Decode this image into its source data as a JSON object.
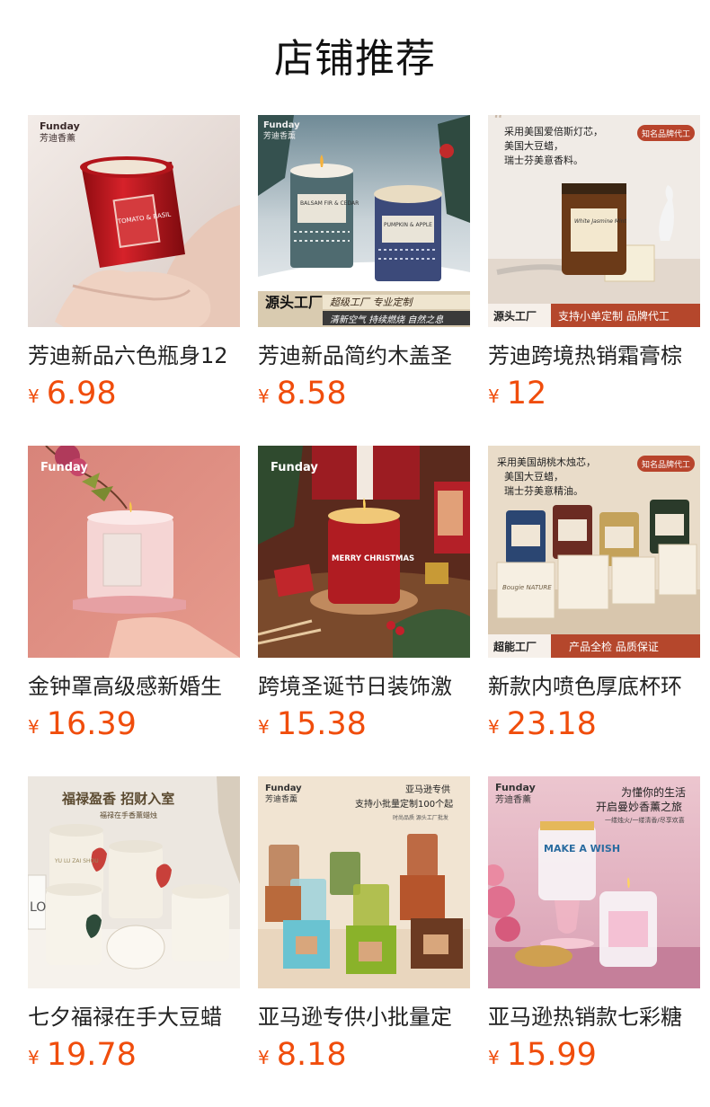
{
  "page": {
    "title": "店铺推荐"
  },
  "colors": {
    "price": "#f04d0c",
    "title": "#111111"
  },
  "products": [
    {
      "name": "芳迪新品六色瓶身12",
      "currency": "¥",
      "price": "6.98",
      "image": {
        "brand": "Funday",
        "brand_cn": "芳迪香薰",
        "jar_text": "TOMATO & BASIL"
      }
    },
    {
      "name": "芳迪新品简约木盖圣",
      "currency": "¥",
      "price": "8.58",
      "image": {
        "brand": "Funday",
        "brand_cn": "芳迪香薰",
        "jar1_text": "BALSAM FIR & CEDAR",
        "jar2_text": "PUMPKIN & APPLE",
        "corner_label": "源头工厂",
        "banner1": "超级工厂  专业定制",
        "banner2": "清新空气 持续燃烧 自然之息"
      }
    },
    {
      "name": "芳迪跨境热销霜膏棕",
      "currency": "¥",
      "price": "12",
      "image": {
        "quote_l1": "采用美国爱倍斯灯芯，",
        "quote_l2": "美国大豆蜡，",
        "quote_l3": "瑞士芬美意香料。",
        "badge": "知名品牌代工",
        "jar_text": "White Jasmine Mint",
        "footer_left": "源头工厂",
        "footer_right": "支持小单定制 品牌代工"
      }
    },
    {
      "name": "金钟罩高级感新婚生",
      "currency": "¥",
      "price": "16.39",
      "image": {
        "brand": "Funday"
      }
    },
    {
      "name": "跨境圣诞节日装饰激",
      "currency": "¥",
      "price": "15.38",
      "image": {
        "brand": "Funday",
        "jar_text": "MERRY CHRISTMAS"
      }
    },
    {
      "name": "新款内喷色厚底杯环",
      "currency": "¥",
      "price": "23.18",
      "image": {
        "quote_l1": "采用美国胡桃木烛芯，",
        "quote_l2": "美国大豆蜡，",
        "quote_l3": "瑞士芬美意精油。",
        "badge": "知名品牌代工",
        "box_text": "Bougie NATURE",
        "footer_left": "超能工厂",
        "footer_right": "产品全检  品质保证"
      }
    },
    {
      "name": "七夕福禄在手大豆蜡",
      "currency": "¥",
      "price": "19.78",
      "image": {
        "headline": "福禄盈香 招财入室",
        "subline": "福禄在手香薰蜡烛",
        "side_text": "LO",
        "jar_text": "YU LU ZAI SHOU"
      }
    },
    {
      "name": "亚马逊专供小批量定",
      "currency": "¥",
      "price": "8.18",
      "image": {
        "brand": "Funday",
        "brand_cn": "芳迪香薰",
        "headline": "亚马逊专供",
        "subline": "支持小批量定制100个起",
        "note": "时尚品质 源头工厂批发"
      }
    },
    {
      "name": "亚马逊热销款七彩糖",
      "currency": "¥",
      "price": "15.99",
      "image": {
        "brand": "Funday",
        "brand_cn": "芳迪香薰",
        "line1": "为懂你的生活",
        "line2": "开启曼妙香薰之旅",
        "line3": "一缕烛火/一缕清香/尽享欢喜",
        "jar_text": "MAKE A WISH"
      }
    }
  ]
}
